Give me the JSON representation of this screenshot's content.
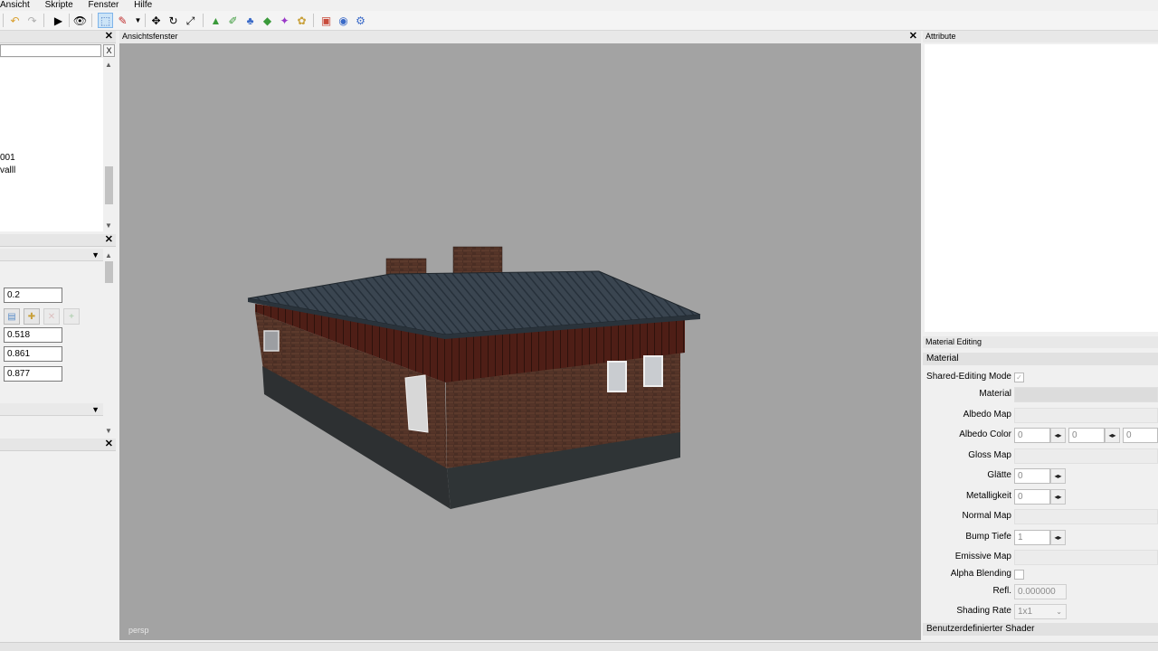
{
  "menu": [
    "Ansicht",
    "Skripte",
    "Fenster",
    "Hilfe"
  ],
  "toolbar": {
    "icons": [
      "separator",
      "undo-icon",
      "redo-icon",
      "play-icon",
      "eye-icon",
      "select-icon",
      "edit-icon",
      "dropdown-icon",
      "move-icon",
      "rotate-icon",
      "scale-icon",
      "terrain-icon",
      "paint-icon",
      "foliage-icon",
      "object-icon",
      "placement-icon",
      "decal-icon",
      "camera-icon",
      "globe-icon",
      "gear-icon"
    ]
  },
  "scenegraph": {
    "items": [
      "001",
      "valll"
    ]
  },
  "properties": {
    "values": [
      "0.2",
      "0.518",
      "0.861",
      "0.877"
    ]
  },
  "viewport": {
    "title": "Ansichtsfenster",
    "camera": "persp"
  },
  "attributes": {
    "title": "Attribute"
  },
  "material_editing": {
    "title": "Material Editing",
    "section": "Material",
    "shared_mode_label": "Shared-Editing Mode",
    "material_label": "Material",
    "albedo_map_label": "Albedo Map",
    "albedo_color_label": "Albedo Color",
    "albedo_color_values": [
      "0",
      "0",
      "0"
    ],
    "gloss_map_label": "Gloss Map",
    "glaette_label": "Glätte",
    "glaette_value": "0",
    "metallic_label": "Metalligkeit",
    "metallic_value": "0",
    "normal_map_label": "Normal Map",
    "bump_label": "Bump Tiefe",
    "bump_value": "1",
    "emissive_label": "Emissive Map",
    "alpha_label": "Alpha Blending",
    "refl_label": "Refl.",
    "refl_value": "0.000000",
    "shading_label": "Shading Rate",
    "shading_value": "1x1",
    "custom_shader": "Benutzerdefinierter Shader"
  }
}
